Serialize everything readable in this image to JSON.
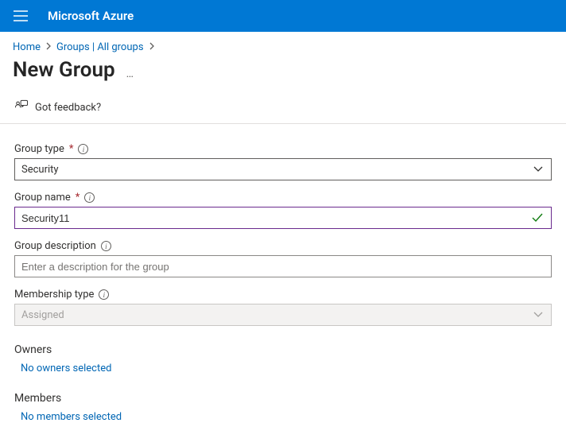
{
  "header": {
    "brand": "Microsoft Azure"
  },
  "breadcrumb": {
    "home": "Home",
    "groups": "Groups | All groups"
  },
  "page": {
    "title": "New Group"
  },
  "feedback": {
    "label": "Got feedback?"
  },
  "form": {
    "group_type": {
      "label": "Group type",
      "value": "Security"
    },
    "group_name": {
      "label": "Group name",
      "value": "Security11"
    },
    "group_description": {
      "label": "Group description",
      "placeholder": "Enter a description for the group",
      "value": ""
    },
    "membership_type": {
      "label": "Membership type",
      "value": "Assigned"
    },
    "owners": {
      "header": "Owners",
      "link": "No owners selected"
    },
    "members": {
      "header": "Members",
      "link": "No members selected"
    }
  }
}
